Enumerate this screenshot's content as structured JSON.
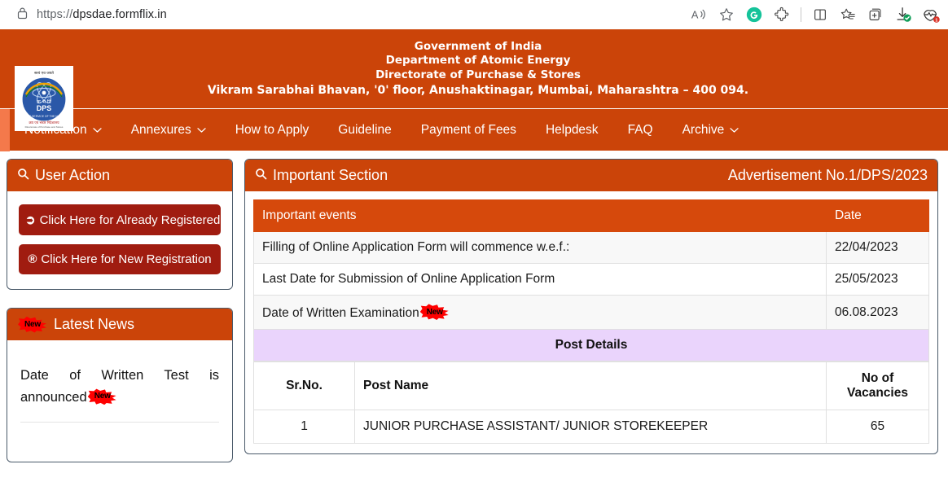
{
  "browser": {
    "url_scheme": "https://",
    "url_host": "dpsdae.formflix.in",
    "url_full": "https://dpsdae.formflix.in",
    "toolbar_icons": [
      "read-aloud-icon",
      "favorite-star-icon",
      "grammarly-icon",
      "extensions-puzzle-icon",
      "split-screen-icon",
      "favorites-list-icon",
      "collections-icon",
      "downloads-icon",
      "browser-essentials-icon"
    ],
    "downloads_badge": "check",
    "essentials_badge": "1"
  },
  "site_header": {
    "line1": "Government of India",
    "line2": "Department of Atomic Energy",
    "line3": "Directorate of Purchase & Stores",
    "line4": "Vikram Sarabhai Bhavan, '0' floor, Anushaktinagar, Mumbai, Maharashtra – 400 094.",
    "logo_alt": "DPS",
    "logo_sub": "DPS"
  },
  "nav": {
    "items": [
      {
        "label": "Notification",
        "has_dropdown": true
      },
      {
        "label": "Annexures",
        "has_dropdown": true
      },
      {
        "label": "How to Apply",
        "has_dropdown": false
      },
      {
        "label": "Guideline",
        "has_dropdown": false
      },
      {
        "label": "Payment of Fees",
        "has_dropdown": false
      },
      {
        "label": "Helpdesk",
        "has_dropdown": false
      },
      {
        "label": "FAQ",
        "has_dropdown": false
      },
      {
        "label": "Archive",
        "has_dropdown": true
      }
    ]
  },
  "user_action": {
    "title": "User Action",
    "already_registered_label": "Click Here for Already Registered",
    "new_registration_label": "Click Here for New Registration"
  },
  "latest_news": {
    "title": "Latest News",
    "badge": "New",
    "item_text": "Date of Written Test is announced"
  },
  "important_section": {
    "title": "Important Section",
    "advertisement": "Advertisement No.1/DPS/2023",
    "events_table": {
      "headers": [
        "Important events",
        "Date"
      ],
      "rows": [
        {
          "event": "Filling of Online Application Form will commence w.e.f.:",
          "date": "22/04/2023",
          "badge": ""
        },
        {
          "event": "Last Date for Submission of Online Application Form",
          "date": "25/05/2023",
          "badge": ""
        },
        {
          "event": "Date of Written Examination",
          "date": "06.08.2023",
          "badge": "New"
        }
      ]
    },
    "post_details": {
      "section_title": "Post Details",
      "headers": [
        "Sr.No.",
        "Post Name",
        "No of Vacancies"
      ],
      "rows": [
        {
          "sr": "1",
          "post_name": "JUNIOR PURCHASE ASSISTANT/ JUNIOR STOREKEEPER",
          "vacancies": "65"
        }
      ]
    }
  },
  "colors": {
    "brand_orange": "#cb4409",
    "nav_accent": "#f4794b",
    "button_red": "#a01c10",
    "table_header": "#d6490c",
    "post_details_bg": "#ead4fc",
    "badge_red": "#fe0000"
  }
}
